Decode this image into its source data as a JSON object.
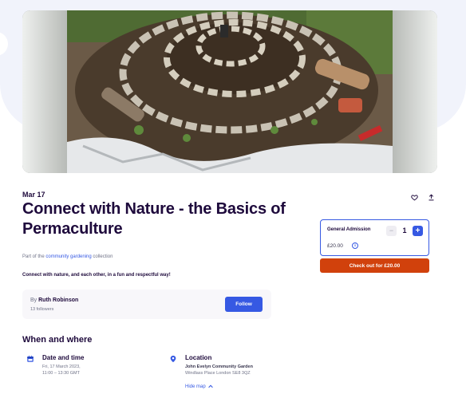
{
  "event": {
    "date_short": "Mar 17",
    "title": "Connect with Nature - the Basics of Permaculture",
    "collection_prefix": "Part of the",
    "collection_link": "community gardening",
    "collection_suffix": "collection",
    "summary": "Connect with nature, and each other, in a fun and respectful way!"
  },
  "organizer": {
    "by_prefix": "By",
    "name": "Ruth Robinson",
    "followers": "13 followers",
    "follow_label": "Follow"
  },
  "when_where": {
    "heading": "When and where",
    "date_time": {
      "title": "Date and time",
      "line1": "Fri, 17 March 2023,",
      "line2": "11:00 – 13:30 GMT"
    },
    "location": {
      "title": "Location",
      "venue": "John Evelyn Community Garden",
      "address": "Windlass Place London SE8 3QZ",
      "hide_map": "Hide map"
    }
  },
  "ticket": {
    "name": "General Admission",
    "quantity": "1",
    "price": "£20.00",
    "minus": "−",
    "plus": "+",
    "info": "i",
    "checkout_label": "Check out for £20.00"
  },
  "icons": {
    "like": "heart-icon",
    "share": "share-icon",
    "calendar": "calendar-icon",
    "location": "location-pin-icon",
    "hide_map_chevron": "chevron-up-icon"
  },
  "colors": {
    "primary": "#3659e3",
    "checkout": "#d1410c",
    "heading": "#1e0a3c",
    "muted": "#6f7287"
  }
}
